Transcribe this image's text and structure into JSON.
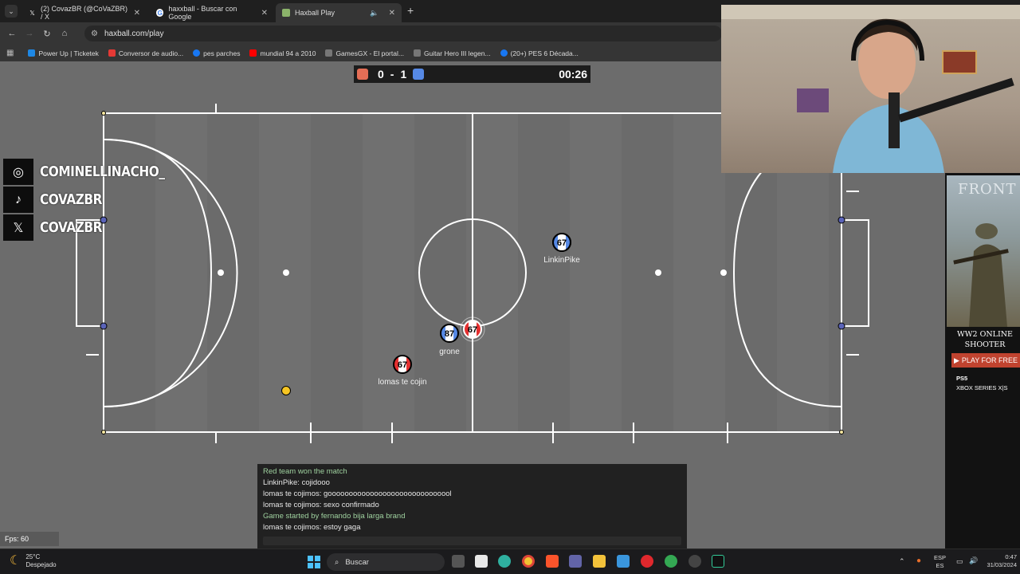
{
  "browser": {
    "tabs": [
      {
        "title": "(2) CovazBR (@CoVaZBR) / X",
        "icon": "x-logo-icon"
      },
      {
        "title": "haxxball - Buscar con Google",
        "icon": "google-icon"
      },
      {
        "title": "Haxball Play",
        "icon": "haxball-icon"
      }
    ],
    "new_tab": "+",
    "url": "haxball.com/play",
    "bookmarks": [
      {
        "label": "Power Up | Ticketek",
        "color": "#1e88e5"
      },
      {
        "label": "Conversor de audio...",
        "color": "#e53935"
      },
      {
        "label": "pes parches",
        "color": "#1877f2"
      },
      {
        "label": "mundial 94 a 2010",
        "color": "#ff0000"
      },
      {
        "label": "GamesGX - El portal...",
        "color": "#777777"
      },
      {
        "label": "Guitar Hero III legen...",
        "color": "#777777"
      },
      {
        "label": "(20+) PES 6 Década...",
        "color": "#1877f2"
      }
    ]
  },
  "scoreboard": {
    "red_score": "0",
    "separator": "-",
    "blue_score": "1",
    "time": "00:26",
    "red_color": "#e56e56",
    "blue_color": "#5689e5"
  },
  "players": [
    {
      "name": "LinkinPike",
      "avatar": "67",
      "team": "blue"
    },
    {
      "name": "grone",
      "avatar": "87",
      "team": "blue"
    },
    {
      "name": "",
      "avatar": "67",
      "team": "red"
    },
    {
      "name": "lomas te cojin",
      "avatar": "67",
      "team": "red"
    }
  ],
  "overlay": {
    "social": [
      {
        "icon": "instagram-icon",
        "handle": "COMINELLINACHO_"
      },
      {
        "icon": "tiktok-icon",
        "handle": "COVAZBR"
      },
      {
        "icon": "x-logo-icon",
        "handle": "COVAZBR"
      }
    ]
  },
  "ad": {
    "title": "FRONT",
    "text": "WW2 ONLINE SHOOTER",
    "button": "PLAY FOR FREE",
    "platforms": [
      "PS5",
      "XBOX SERIES X|S"
    ]
  },
  "chat": {
    "messages": [
      {
        "text": "Red team won the match",
        "type": "system"
      },
      {
        "text": "LinkinPike: cojidooo",
        "type": "player"
      },
      {
        "text": "lomas te cojimos: goooooooooooooooooooooooooooool",
        "type": "player"
      },
      {
        "text": "lomas te cojimos: sexo confirmado",
        "type": "player"
      },
      {
        "text": "Game started by fernando bija larga brand",
        "type": "system"
      },
      {
        "text": "lomas te cojimos: estoy gaga",
        "type": "player"
      }
    ]
  },
  "fps": "Fps: 60",
  "taskbar": {
    "weather_temp": "25°C",
    "weather_desc": "Despejado",
    "search_placeholder": "Buscar",
    "lang_1": "ESP",
    "lang_2": "ES",
    "time": "0:47",
    "date": "31/03/2024"
  }
}
